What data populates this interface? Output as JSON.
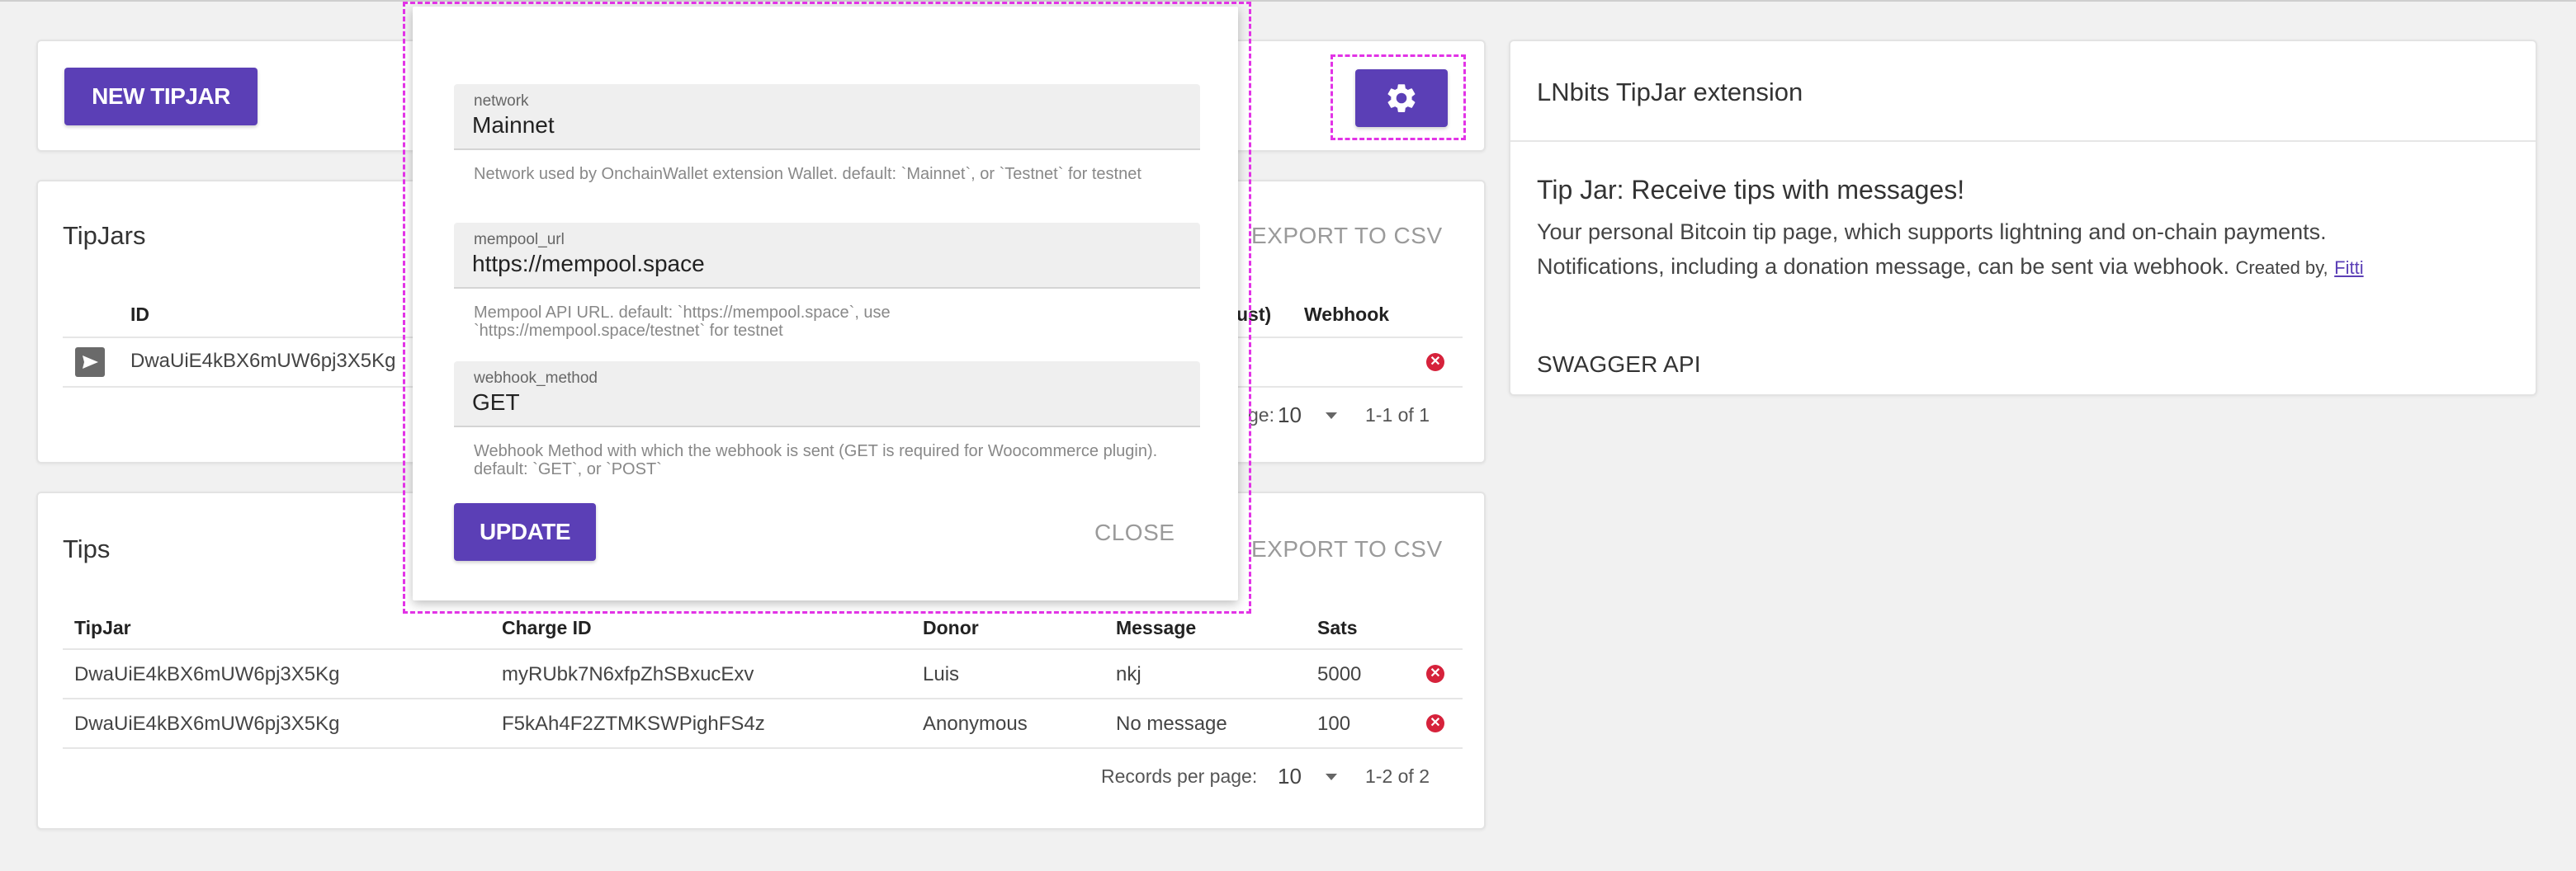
{
  "toolbar": {
    "new_tipjar_label": "NEW TIPJAR",
    "settings_icon": "gear-icon"
  },
  "tipjars": {
    "title": "TipJars",
    "export_label": "EXPORT TO CSV",
    "columns": [
      "ID",
      "ust)",
      "Webhook"
    ],
    "rows": [
      {
        "id": "DwaUiE4kBX6mUW6pj3X5Kg"
      }
    ],
    "records_per_page_label": "ge:",
    "records_per_page": "10",
    "range": "1-1 of 1"
  },
  "tips": {
    "title": "Tips",
    "export_label": "EXPORT TO CSV",
    "columns": [
      "TipJar",
      "Charge ID",
      "Donor",
      "Message",
      "Sats"
    ],
    "rows": [
      {
        "tipjar": "DwaUiE4kBX6mUW6pj3X5Kg",
        "charge_id": "myRUbk7N6xfpZhSBxucExv",
        "donor": "Luis",
        "message": "nkj",
        "sats": "5000"
      },
      {
        "tipjar": "DwaUiE4kBX6mUW6pj3X5Kg",
        "charge_id": "F5kAh4F2ZTMKSWPighFS4z",
        "donor": "Anonymous",
        "message": "No message",
        "sats": "100"
      }
    ],
    "records_per_page_label": "Records per page:",
    "records_per_page": "10",
    "range": "1-2 of 2"
  },
  "dialog": {
    "fields": [
      {
        "label": "network",
        "value": "Mainnet",
        "hint": "Network used by OnchainWallet extension Wallet. default: `Mainnet`, or `Testnet` for testnet"
      },
      {
        "label": "mempool_url",
        "value": "https://mempool.space",
        "hint": "Mempool API URL. default: `https://mempool.space`, use `https://mempool.space/testnet` for testnet"
      },
      {
        "label": "webhook_method",
        "value": "GET",
        "hint": "Webhook Method with which the webhook is sent (GET is required for Woocommerce plugin). default: `GET`, or `POST`"
      }
    ],
    "update_label": "UPDATE",
    "close_label": "CLOSE"
  },
  "info": {
    "title": "LNbits TipJar extension",
    "heading": "Tip Jar: Receive tips with messages!",
    "line1": "Your personal Bitcoin tip page, which supports lightning and on-chain payments.",
    "line2": "Notifications, including a donation message, can be sent via webhook.",
    "created_by": "Created by,",
    "author": "Fitti",
    "swagger_label": "SWAGGER API"
  },
  "colors": {
    "primary": "#5b3fb6",
    "delete": "#d6223b",
    "highlight": "#e233e6"
  }
}
